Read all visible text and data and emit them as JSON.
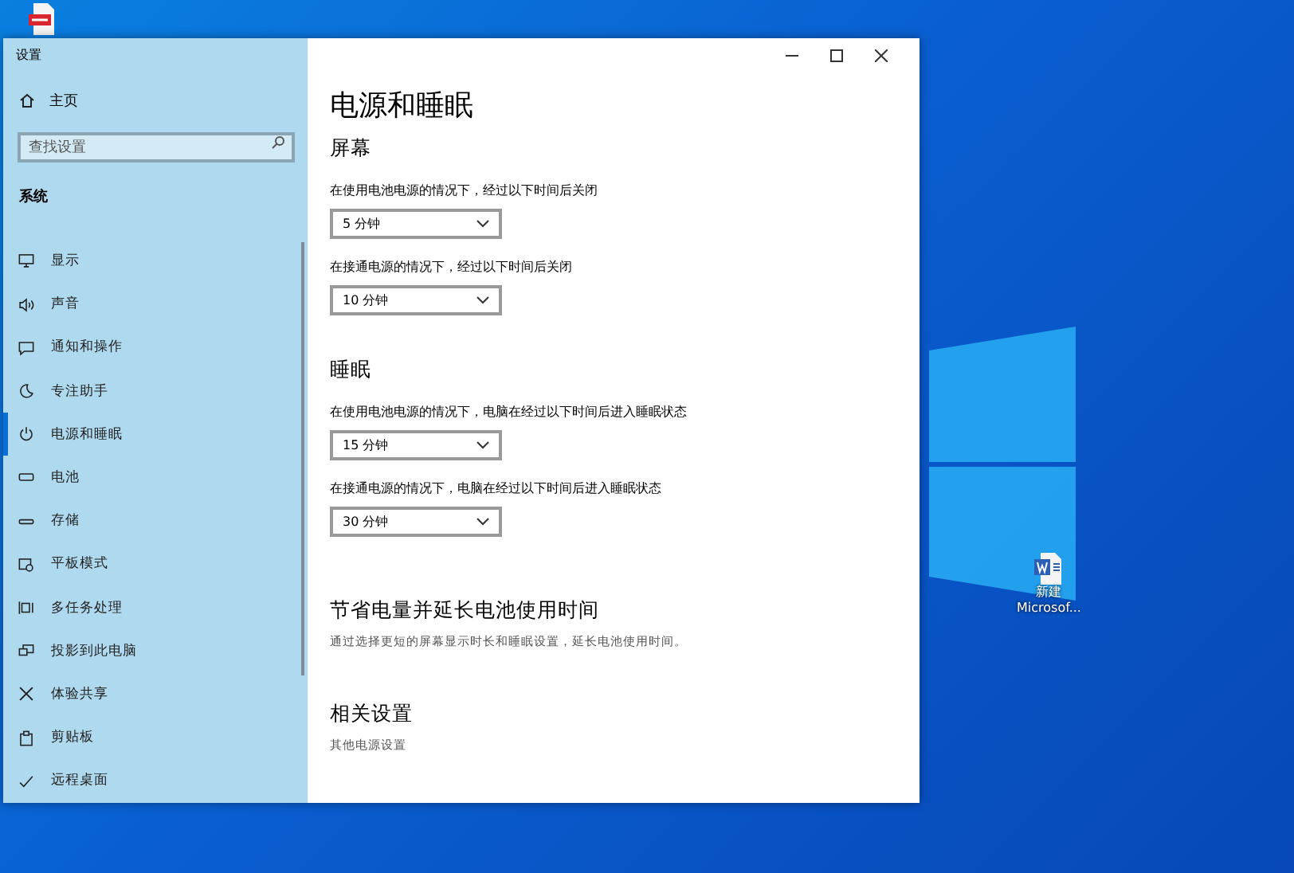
{
  "desktop_icons": [
    {
      "kind": "pdf"
    },
    {
      "kind": "word",
      "lines": [
        "新建",
        "Microsof..."
      ]
    }
  ],
  "window": {
    "title": "设置"
  },
  "sidebar": {
    "home": "主页",
    "search": {
      "placeholder": "查找设置"
    },
    "section": "系统",
    "items": [
      {
        "label": "显示",
        "selected": false
      },
      {
        "label": "声音",
        "selected": false
      },
      {
        "label": "通知和操作",
        "selected": false
      },
      {
        "label": "专注助手",
        "selected": false
      },
      {
        "label": "电源和睡眠",
        "selected": true
      },
      {
        "label": "电池",
        "selected": false
      },
      {
        "label": "存储",
        "selected": false
      },
      {
        "label": "平板模式",
        "selected": false
      },
      {
        "label": "多任务处理",
        "selected": false
      },
      {
        "label": "投影到此电脑",
        "selected": false
      },
      {
        "label": "体验共享",
        "selected": false
      },
      {
        "label": "剪贴板",
        "selected": false
      },
      {
        "label": "远程桌面",
        "selected": false
      }
    ]
  },
  "content": {
    "title": "电源和睡眠",
    "sections": [
      {
        "heading": "屏幕",
        "settings": [
          {
            "label": "在使用电池电源的情况下，经过以下时间后关闭",
            "value": "5 分钟"
          },
          {
            "label": "在接通电源的情况下，经过以下时间后关闭",
            "value": "10 分钟"
          }
        ]
      },
      {
        "heading": "睡眠",
        "settings": [
          {
            "label": "在使用电池电源的情况下，电脑在经过以下时间后进入睡眠状态",
            "value": "15 分钟"
          },
          {
            "label": "在接通电源的情况下，电脑在经过以下时间后进入睡眠状态",
            "value": "30 分钟"
          }
        ]
      }
    ],
    "tip": {
      "heading": "节省电量并延长电池使用时间",
      "text": "通过选择更短的屏幕显示时长和睡眠设置，延长电池使用时间。"
    },
    "related": {
      "heading": "相关设置",
      "link": "其他电源设置"
    }
  }
}
